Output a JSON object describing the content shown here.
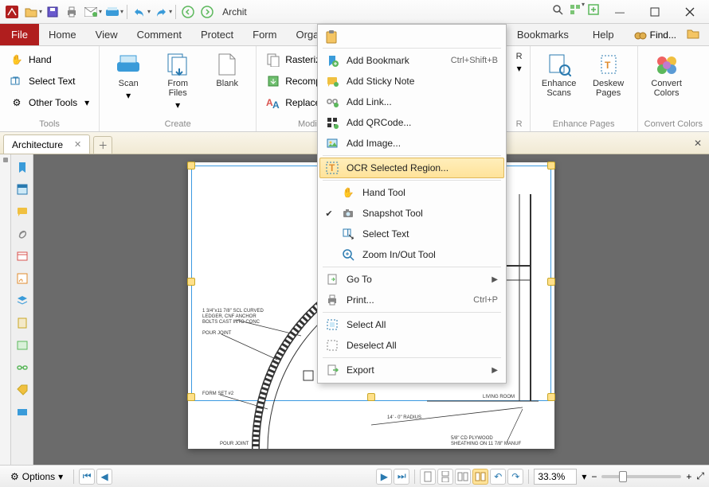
{
  "qat": {
    "title": "Archit"
  },
  "tabs": {
    "file": "File",
    "items": [
      "Home",
      "View",
      "Comment",
      "Protect",
      "Form",
      "Organize",
      "Bookmarks",
      "Help"
    ],
    "find": "Find..."
  },
  "ribbon": {
    "tools": {
      "label": "Tools",
      "hand": "Hand",
      "select_text": "Select Text",
      "other_tools": "Other Tools"
    },
    "create": {
      "label": "Create",
      "scan": "Scan",
      "from_files": "From\nFiles",
      "blank": "Blank"
    },
    "modify": {
      "label": "Modify",
      "rasterize": "Rasterize Pages",
      "recompress": "Recompress Im",
      "replace_fonts": "Replace Fonts"
    },
    "r_label": "R",
    "enhance": {
      "label": "Enhance Pages",
      "enhance_scans": "Enhance\nScans",
      "deskew": "Deskew\nPages"
    },
    "convert": {
      "label": "Convert Colors",
      "btn": "Convert\nColors"
    }
  },
  "doc_tab": {
    "name": "Architecture"
  },
  "context_menu": {
    "add_bookmark": "Add Bookmark",
    "add_bookmark_short": "Ctrl+Shift+B",
    "add_sticky": "Add Sticky Note",
    "add_link": "Add Link...",
    "add_qr": "Add QRCode...",
    "add_image": "Add Image...",
    "ocr": "OCR Selected Region...",
    "hand": "Hand Tool",
    "snapshot": "Snapshot Tool",
    "select_text": "Select Text",
    "zoom": "Zoom In/Out Tool",
    "goto": "Go To",
    "print": "Print...",
    "print_short": "Ctrl+P",
    "select_all": "Select All",
    "deselect_all": "Deselect All",
    "export": "Export"
  },
  "drawing": {
    "note1a": "1 3/4\"x11 7/8\" SCL CURVED",
    "note1b": "LEDGER, CNF ANCHOR",
    "note1c": "BOLTS CAST INTO CONC",
    "pour": "POUR JOINT",
    "pour2": "POUR JOINT",
    "form": "FORM SET #2",
    "radius": "14' - 0\" RADIUS",
    "living": "LIVING ROOM",
    "sheath1": "5/8\" CD PLYWOOD",
    "sheath2": "SHEATHING ON 11 7/8\" MANUF"
  },
  "status": {
    "options": "Options",
    "zoom": "33.3%"
  }
}
